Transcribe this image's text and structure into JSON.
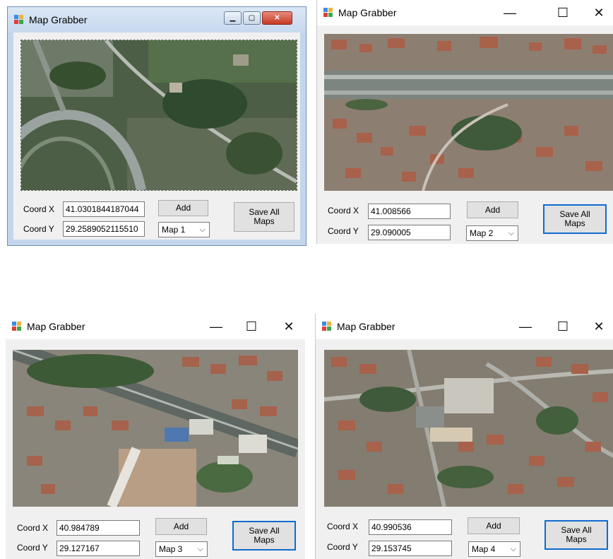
{
  "windows": [
    {
      "title": "Map Grabber",
      "coord_x_label": "Coord X",
      "coord_y_label": "Coord Y",
      "coord_x_value": "41.0301844187044",
      "coord_y_value": "29.2589052115510",
      "add_label": "Add",
      "save_label": "Save All Maps",
      "map_select": "Map 1"
    },
    {
      "title": "Map Grabber",
      "coord_x_label": "Coord X",
      "coord_y_label": "Coord Y",
      "coord_x_value": "41.008566",
      "coord_y_value": "29.090005",
      "add_label": "Add",
      "save_label": "Save All Maps",
      "map_select": "Map 2"
    },
    {
      "title": "Map Grabber",
      "coord_x_label": "Coord X",
      "coord_y_label": "Coord Y",
      "coord_x_value": "40.984789",
      "coord_y_value": "29.127167",
      "add_label": "Add",
      "save_label": "Save All Maps",
      "map_select": "Map 3"
    },
    {
      "title": "Map Grabber",
      "coord_x_label": "Coord X",
      "coord_y_label": "Coord Y",
      "coord_x_value": "40.990536",
      "coord_y_value": "29.153745",
      "add_label": "Add",
      "save_label": "Save All Maps",
      "map_select": "Map 4"
    }
  ],
  "icons": {
    "app": "map-grabber-app-icon",
    "minimize": "minimize-icon",
    "maximize": "maximize-icon",
    "close": "close-icon",
    "dropdown": "chevron-down-icon"
  },
  "colors": {
    "default_button_border": "#0f6bd0",
    "classic_frame": "#c4d6ec",
    "classic_close": "#c43a24",
    "aerial_green": "#3f5a3a",
    "roof_red": "#a8614a"
  }
}
